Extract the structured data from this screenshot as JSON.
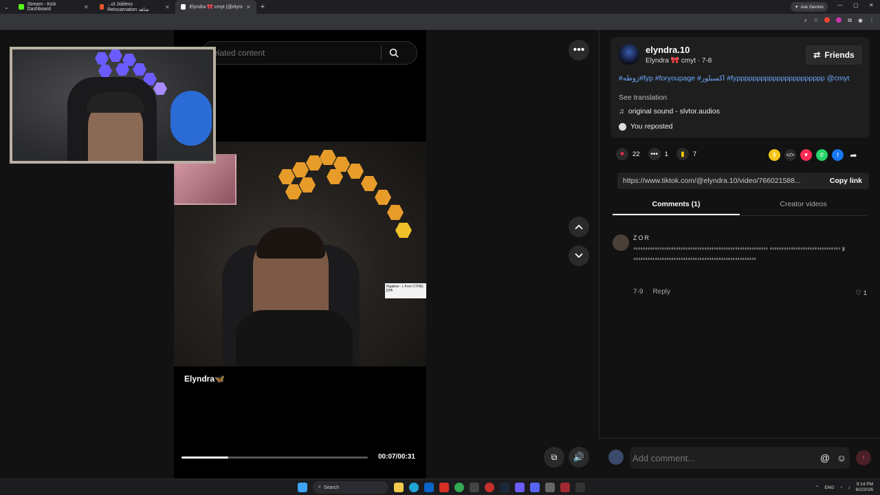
{
  "browser": {
    "tabs": [
      {
        "title": "Stream - Kick Dashboard",
        "color": "#53fc18",
        "active": false
      },
      {
        "title": "...ol Jobless Reincarnation شاهد",
        "color": "#e8562a",
        "active": false
      },
      {
        "title": "Elyndra 🎀 cmyt (@elyndra...",
        "color": "#ffffff",
        "active": true
      }
    ],
    "ask_gemini": "Ask Gemini"
  },
  "video": {
    "search_placeholder": "elated content",
    "creator_label": "Elyndra🦋",
    "time": "00:07/00:31",
    "progress": 0.25,
    "sign_text": "Nujabes - L from CYNE) [Offi"
  },
  "post": {
    "username": "elyndra.10",
    "subline": "Elyndra 🎀 cmyt · 7-8",
    "friends_label": "Friends",
    "description": "#زوطه#fyp #foryoupage #اكسبلور #fypppppppppppppppppppppp @cmyt",
    "see_translation": "See translation",
    "sound": "original sound - slvtor.audios",
    "repost": "You reposted",
    "likes": "22",
    "comments": "1",
    "saves": "7",
    "link": "https://www.tiktok.com/@elyndra.10/video/766021588...",
    "copy_link": "Copy link",
    "tab_comments": "Comments (1)",
    "tab_creator": "Creator videos"
  },
  "comment": {
    "user": "ZOR",
    "text": "⁴⁴⁴⁴⁴⁴⁴⁴⁴⁴⁴⁴⁴⁴⁴⁴⁴⁴⁴⁴⁴⁴⁴⁴⁴⁴⁴⁴⁴⁴⁴⁴⁴⁴⁴⁴⁴⁴⁴⁴⁴⁴⁴⁴⁴⁴⁴⁴⁴⁴⁴⁴⁴⁴⁴⁴⁴ لا ⁴⁴⁴⁴⁴⁴⁴⁴⁴⁴⁴⁴⁴⁴⁴⁴⁴⁴⁴⁴⁴⁴⁴⁴⁴⁴⁴⁴⁴⁴⁴⁴⁴⁴⁴⁴⁴⁴⁴⁴⁴⁴⁴⁴⁴⁴⁴⁴⁴⁴⁴⁴⁴⁴⁴⁴⁴⁴⁴⁴⁴⁴⁴⁴⁴⁴⁴⁴⁴⁴⁴⁴⁴⁴⁴⁴⁴⁴⁴⁴⁴⁴",
    "date": "7-9",
    "reply": "Reply",
    "likes": "1"
  },
  "composer": {
    "placeholder": "Add comment..."
  },
  "taskbar": {
    "search": "Search",
    "lang": "ENG",
    "time": "9:14 PM",
    "date": "8/2/2026"
  }
}
